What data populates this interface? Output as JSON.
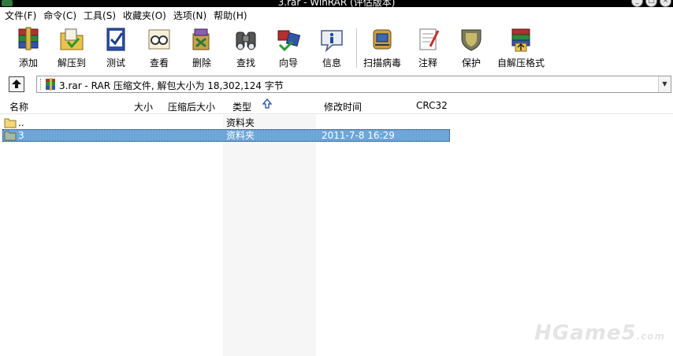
{
  "window": {
    "title": "3.rar - WinRAR (评估版本)",
    "controls": [
      "_",
      "□",
      "×"
    ]
  },
  "menubar": [
    "文件(F)",
    "命令(C)",
    "工具(S)",
    "收藏夹(O)",
    "选项(N)",
    "帮助(H)"
  ],
  "toolbar": [
    {
      "label": "添加",
      "icon": "add-archive-icon"
    },
    {
      "label": "解压到",
      "icon": "extract-to-icon"
    },
    {
      "label": "测试",
      "icon": "test-icon"
    },
    {
      "label": "查看",
      "icon": "view-icon"
    },
    {
      "label": "删除",
      "icon": "delete-icon"
    },
    {
      "label": "查找",
      "icon": "find-binoculars-icon"
    },
    {
      "label": "向导",
      "icon": "wizard-icon"
    },
    {
      "label": "信息",
      "icon": "info-icon"
    },
    {
      "label": "扫描病毒",
      "icon": "virus-scan-icon"
    },
    {
      "label": "注释",
      "icon": "comment-icon"
    },
    {
      "label": "保护",
      "icon": "protect-shield-icon"
    },
    {
      "label": "自解压格式",
      "icon": "sfx-icon"
    }
  ],
  "address": {
    "text": "3.rar - RAR 压缩文件, 解包大小为 18,302,124 字节"
  },
  "columns": {
    "name": "名称",
    "size": "大小",
    "packed": "压缩后大小",
    "type": "类型",
    "modified": "修改时间",
    "crc": "CRC32"
  },
  "rows": [
    {
      "name": "..",
      "type": "资料夹",
      "modified": "",
      "selected": false
    },
    {
      "name": "3",
      "type": "资料夹",
      "modified": "2011-7-8 16:29",
      "selected": true
    }
  ],
  "watermark": {
    "main": "HGame5",
    "suffix": ".com"
  },
  "colors": {
    "selection": "#6ea6d8",
    "type_column": "#f6f6f6"
  }
}
